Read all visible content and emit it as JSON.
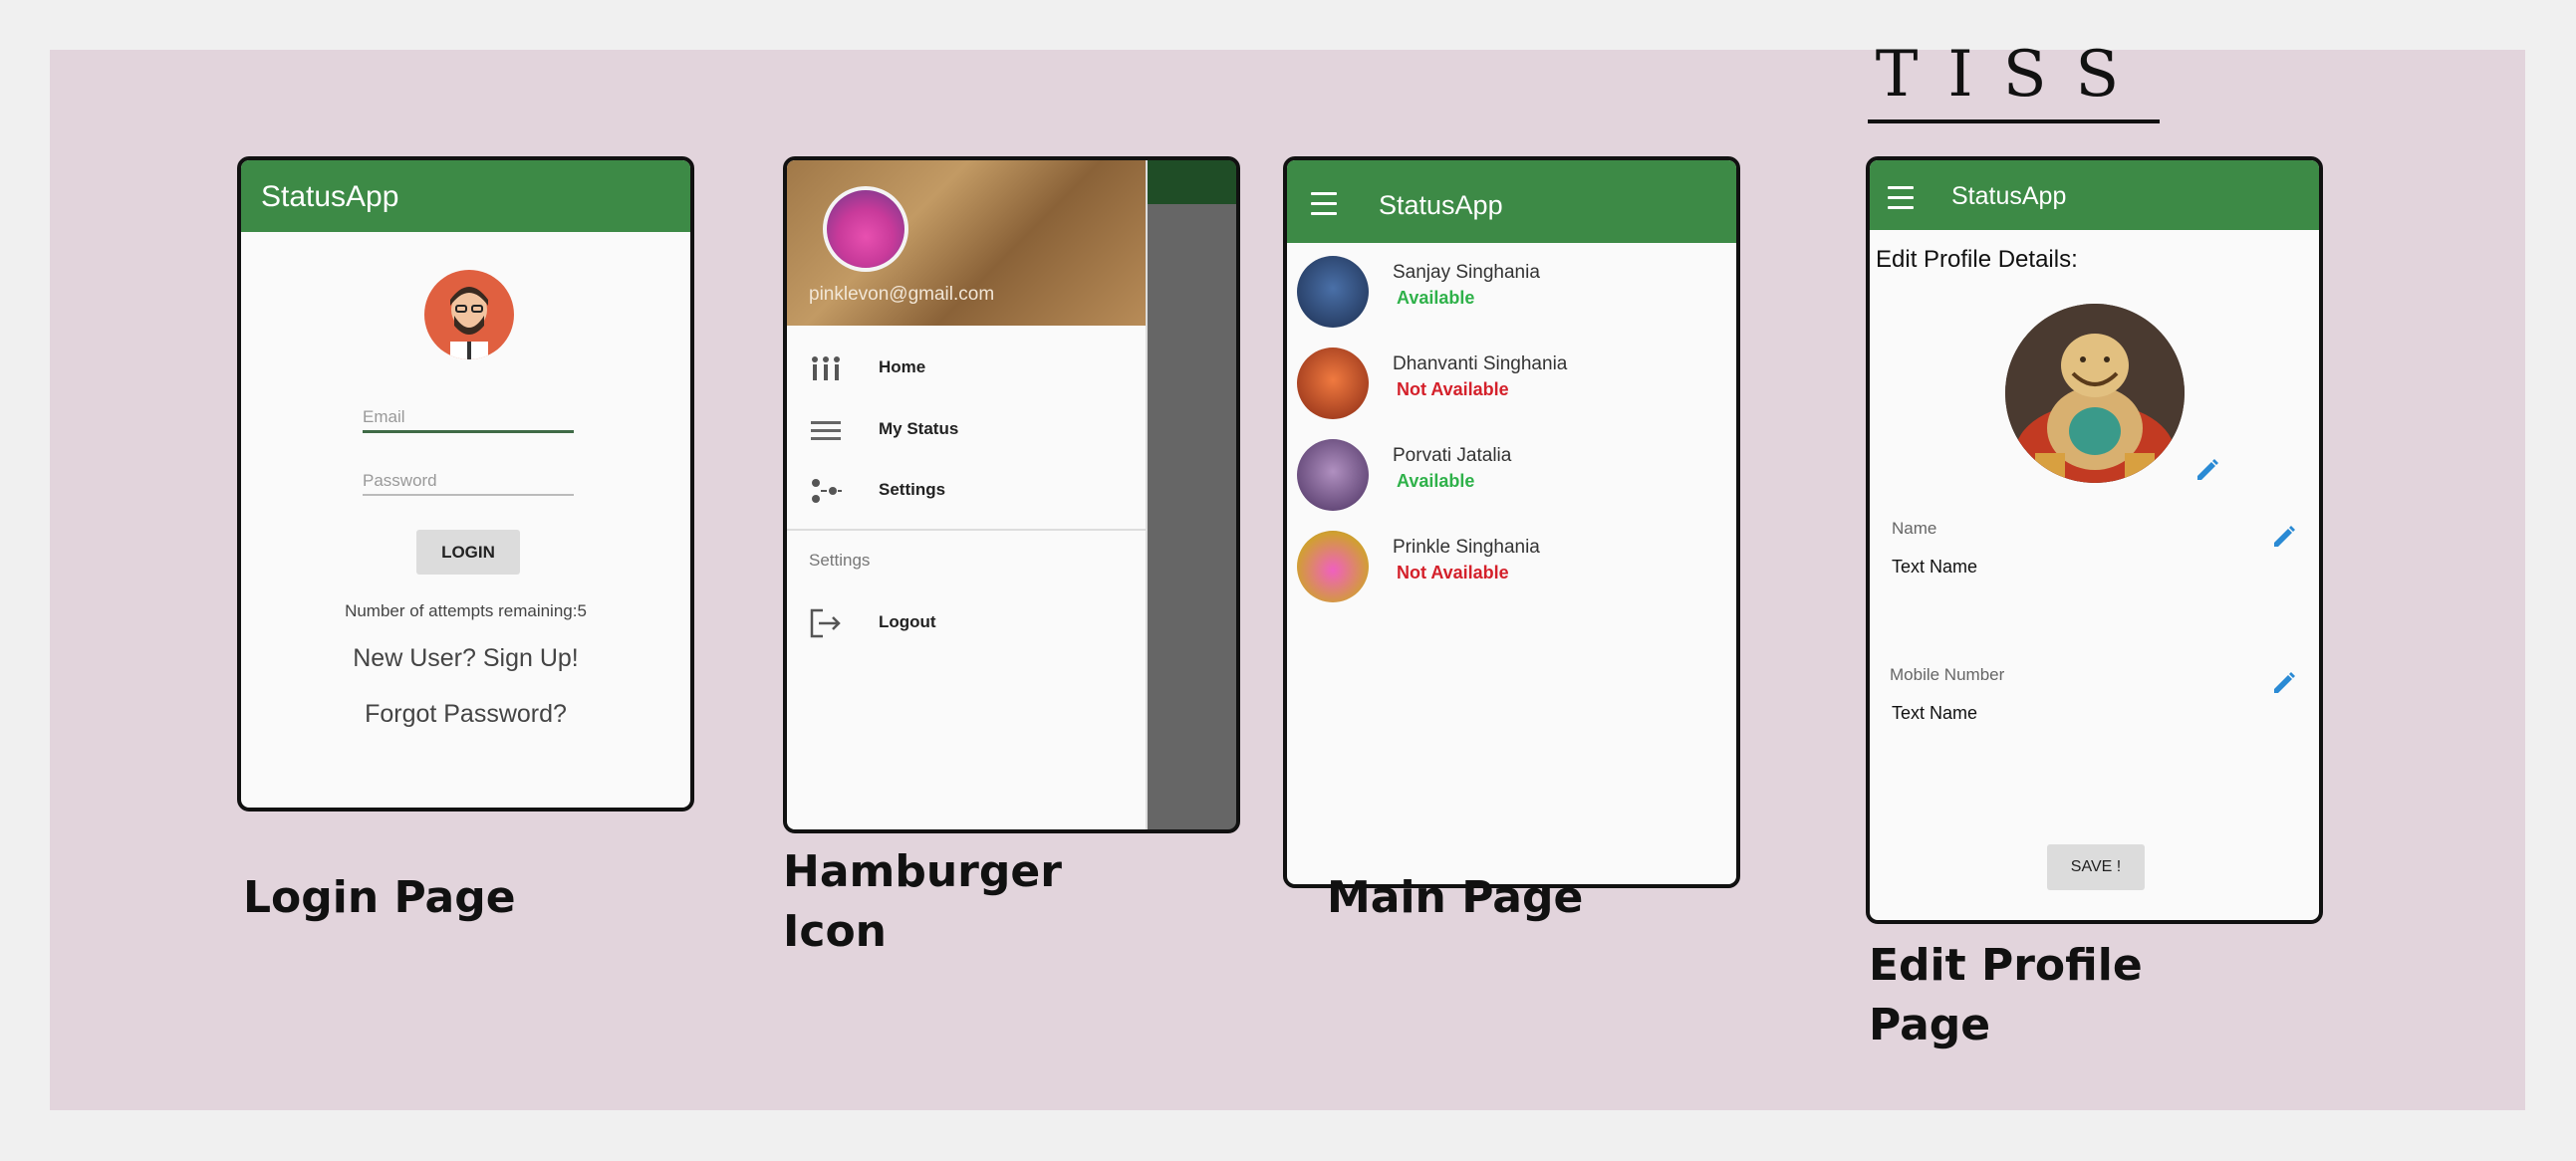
{
  "header": {
    "brand": "TISS"
  },
  "app_title": "StatusApp",
  "login": {
    "email_placeholder": "Email",
    "password_placeholder": "Password",
    "login_button": "LOGIN",
    "attempts_text": "Number of attempts remaining:5",
    "signup_link": "New User? Sign Up!",
    "forgot_link": "Forgot Password?",
    "caption": "Login Page"
  },
  "drawer": {
    "email": "pinklevon@gmail.com",
    "items": [
      {
        "label": "Home",
        "icon": "home-icon"
      },
      {
        "label": "My Status",
        "icon": "list-icon"
      },
      {
        "label": "Settings",
        "icon": "settings-icon"
      }
    ],
    "section_label": "Settings",
    "logout": {
      "label": "Logout",
      "icon": "logout-icon"
    },
    "caption_line1": "Hamburger",
    "caption_line2": "Icon"
  },
  "main": {
    "contacts": [
      {
        "name": "Sanjay Singhania",
        "status": "Available",
        "available": true,
        "color": "#2a4a7a"
      },
      {
        "name": "Dhanvanti Singhania",
        "status": "Not Available",
        "available": false,
        "color": "#c8582a"
      },
      {
        "name": "Porvati Jatalia",
        "status": "Available",
        "available": true,
        "color": "#7a5a8a"
      },
      {
        "name": "Prinkle Singhania",
        "status": "Not Available",
        "available": false,
        "color": "#d846a8"
      }
    ],
    "caption": "Main Page"
  },
  "edit": {
    "heading": "Edit Profile Details:",
    "name_label": "Name",
    "name_value": "Text Name",
    "mobile_label": "Mobile Number",
    "mobile_value": "Text Name",
    "save_button": "SAVE !",
    "caption_line1": "Edit Profile",
    "caption_line2": "Page"
  },
  "colors": {
    "appbar": "#3d8a46",
    "board": "#e2d4dc",
    "available": "#2fb14a",
    "not_available": "#d4202a",
    "pencil": "#2a8ad4"
  }
}
